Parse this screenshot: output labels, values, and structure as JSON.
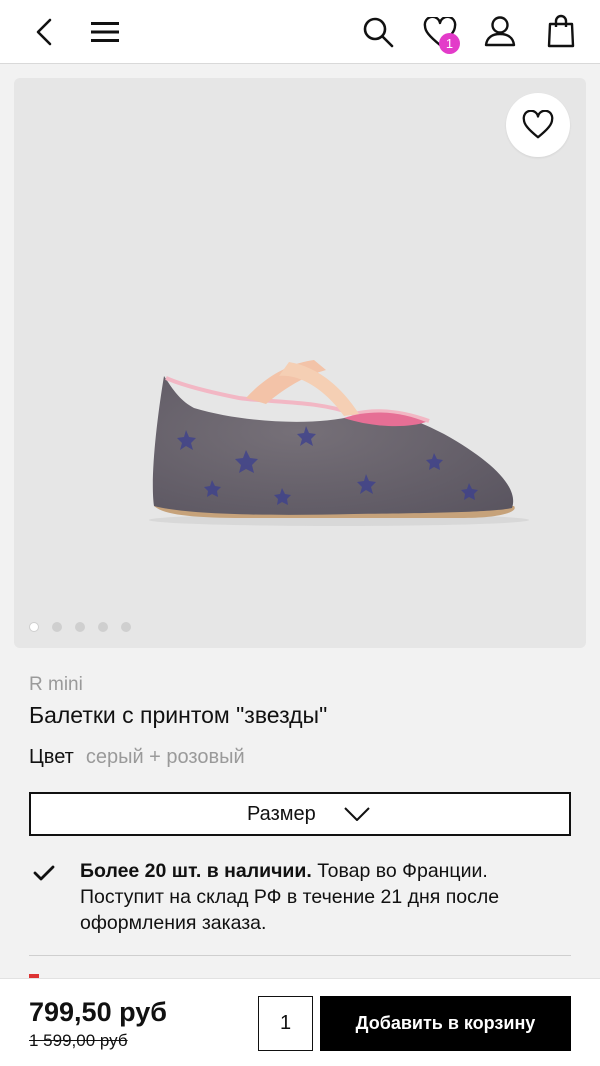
{
  "header": {
    "back_icon": "chevron-left-icon",
    "menu_icon": "hamburger-icon",
    "search_icon": "search-icon",
    "wishlist_icon": "heart-icon",
    "wishlist_count": "1",
    "account_icon": "user-icon",
    "cart_icon": "shopping-bag-icon",
    "badge_color": "#e33bc9"
  },
  "gallery": {
    "image": "grey-ballet-flat-with-pink-straps",
    "favorite_icon": "heart-icon",
    "total_images": 5,
    "active_index": 0
  },
  "product": {
    "brand": "R mini",
    "title": "Балетки с принтом \"звезды\"",
    "color_label": "Цвет",
    "color_value": "серый + розовый",
    "size_label": "Размер",
    "stock_bold": "Более 20 шт. в наличии.",
    "stock_text": " Товар во Франции. Поступит на склад РФ в течение 21 дня после оформления заказа."
  },
  "purchase": {
    "price": "799,50 руб",
    "old_price": "1 599,00 руб",
    "quantity": "1",
    "add_to_cart": "Добавить в корзину"
  }
}
